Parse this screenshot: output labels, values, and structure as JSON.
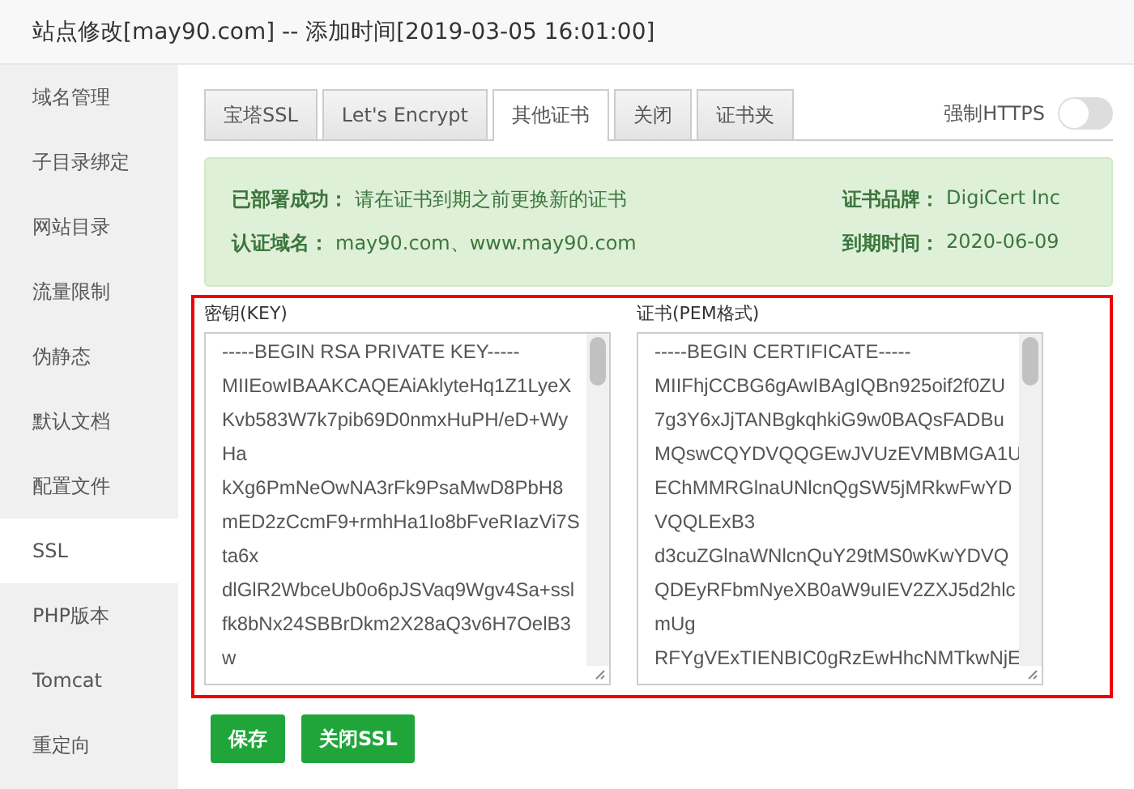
{
  "window": {
    "title": "站点修改[may90.com] -- 添加时间[2019-03-05 16:01:00]"
  },
  "sidebar": {
    "items": [
      {
        "label": "域名管理",
        "selected": false
      },
      {
        "label": "子目录绑定",
        "selected": false
      },
      {
        "label": "网站目录",
        "selected": false
      },
      {
        "label": "流量限制",
        "selected": false
      },
      {
        "label": "伪静态",
        "selected": false
      },
      {
        "label": "默认文档",
        "selected": false
      },
      {
        "label": "配置文件",
        "selected": false
      },
      {
        "label": "SSL",
        "selected": true
      },
      {
        "label": "PHP版本",
        "selected": false
      },
      {
        "label": "Tomcat",
        "selected": false
      },
      {
        "label": "重定向",
        "selected": false
      }
    ]
  },
  "tabs": [
    {
      "label": "宝塔SSL",
      "selected": false
    },
    {
      "label": "Let's Encrypt",
      "selected": false
    },
    {
      "label": "其他证书",
      "selected": true
    },
    {
      "label": "关闭",
      "selected": false
    },
    {
      "label": "证书夹",
      "selected": false
    }
  ],
  "force_https": {
    "label": "强制HTTPS",
    "on": false
  },
  "status_box": {
    "rows": [
      {
        "label": "已部署成功：",
        "value": "请在证书到期之前更换新的证书",
        "side_label": "证书品牌：",
        "side_value": "DigiCert Inc"
      },
      {
        "label": "认证域名：",
        "value": "may90.com、www.may90.com",
        "side_label": "到期时间：",
        "side_value": "2020-06-09"
      }
    ]
  },
  "fields": [
    {
      "label": "密钥(KEY)",
      "lines": [
        "-----BEGIN RSA PRIVATE KEY-----",
        "MIIEowIBAAKCAQEAiAklyteHq1Z1LyeX",
        "Kvb583W7k7pib69D0nmxHuPH/eD+Wy",
        "Ha",
        "kXg6PmNeOwNA3rFk9PsaMwD8PbH8",
        "mED2zCcmF9+rmhHa1Io8bFveRIazVi7S",
        "ta6x",
        "dlGlR2WbceUb0o6pJSVaq9Wgv4Sa+ssl",
        "fk8bNx24SBBrDkm2X28aQ3v6H7OelB3",
        "w"
      ]
    },
    {
      "label": "证书(PEM格式)",
      "lines": [
        "-----BEGIN CERTIFICATE-----",
        "MIIFhjCCBG6gAwIBAgIQBn925oif2f0ZU",
        "7g3Y6xJjTANBgkqhkiG9w0BAQsFADBu",
        "MQswCQYDVQQGEwJVUzEVMBMGA1U",
        "EChMMRGlnaUNlcnQgSW5jMRkwFwYD",
        "VQQLExB3",
        "d3cuZGlnaWNlcnQuY29tMS0wKwYDVQ",
        "QDEyRFbmNyeXB0aW9uIEV2ZXJ5d2hlc",
        "mUg",
        "RFYgVExTIENBIC0gRzEwHhcNMTkwNjE"
      ]
    }
  ],
  "buttons": [
    {
      "label": "保存"
    },
    {
      "label": "关闭SSL"
    }
  ]
}
